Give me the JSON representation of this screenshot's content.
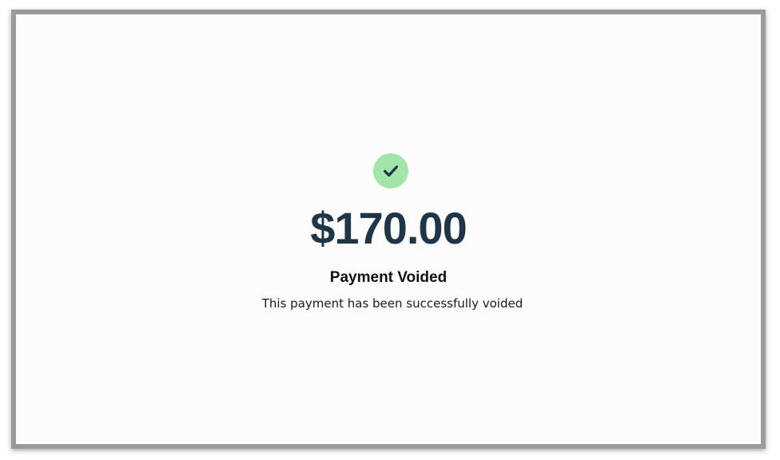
{
  "payment": {
    "status_icon": "check-icon",
    "amount": "$170.00",
    "title": "Payment Voided",
    "message": "This payment has been successfully voided"
  },
  "colors": {
    "success_circle": "#a3e4a9",
    "check_mark": "#1f3548",
    "amount_text": "#1f3548",
    "background": "#fcfcfc",
    "frame_border": "#9b9b9b"
  }
}
